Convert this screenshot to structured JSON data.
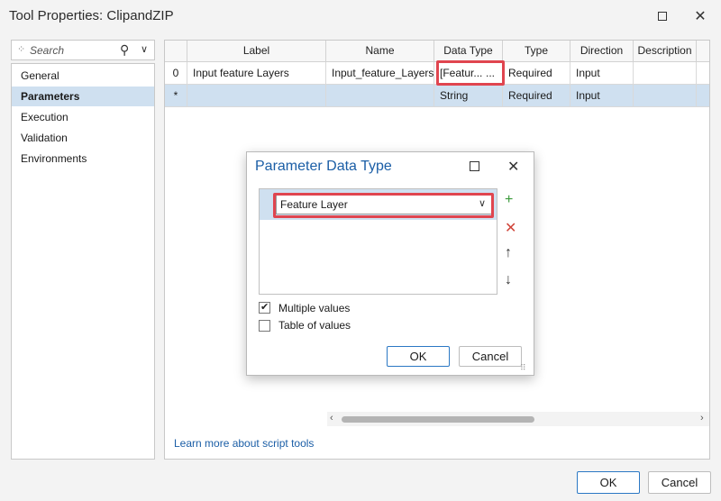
{
  "window": {
    "title": "Tool Properties: ClipandZIP"
  },
  "search": {
    "placeholder": "Search"
  },
  "sidebar": {
    "items": [
      {
        "label": "General"
      },
      {
        "label": "Parameters"
      },
      {
        "label": "Execution"
      },
      {
        "label": "Validation"
      },
      {
        "label": "Environments"
      }
    ],
    "selected": "Parameters"
  },
  "table": {
    "columns": [
      "Label",
      "Name",
      "Data Type",
      "Type",
      "Direction",
      "Description"
    ],
    "rows": [
      {
        "index": "0",
        "label": "Input feature Layers",
        "name": "Input_feature_Layers",
        "data_type": "[Featur...",
        "data_type_button": "...",
        "type": "Required",
        "direction": "Input"
      },
      {
        "index": "*",
        "label": "",
        "name": "",
        "data_type": "String",
        "type": "Required",
        "direction": "Input"
      }
    ]
  },
  "links": {
    "learn_more": "Learn more about script tools"
  },
  "buttons": {
    "ok": "OK",
    "cancel": "Cancel"
  },
  "dialog": {
    "title": "Parameter Data Type",
    "selected_type": "Feature Layer",
    "multiple_values": {
      "label": "Multiple values",
      "checked": true
    },
    "table_of_values": {
      "label": "Table of values",
      "checked": false
    },
    "ok": "OK",
    "cancel": "Cancel"
  },
  "colors": {
    "accent": "#1b5ea6",
    "selection": "#cfe0f0",
    "highlight": "#e0454f",
    "add_icon": "#3a9a3a",
    "remove_icon": "#d0453a"
  }
}
